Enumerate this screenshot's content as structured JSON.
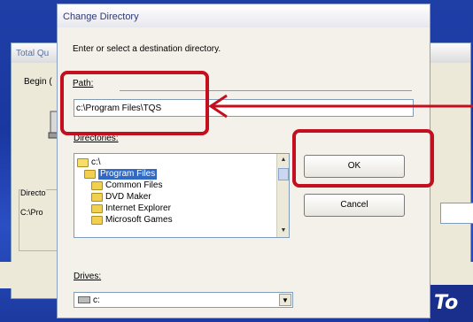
{
  "background_window": {
    "title": "Total Qu",
    "begin_text": "Begin (",
    "directory_label": "Directo",
    "directory_value": "C:\\Pro"
  },
  "brand": {
    "text": "To"
  },
  "dialog": {
    "title": "Change Directory",
    "prompt": "Enter or select a destination directory.",
    "path_label": "Path:",
    "path_value": "c:\\Program Files\\TQS",
    "directories_label": "Directories:",
    "directories": [
      {
        "label": "c:\\",
        "state": "open"
      },
      {
        "label": "Program Files",
        "state": "selected"
      },
      {
        "label": "Common Files",
        "state": "closed"
      },
      {
        "label": "DVD Maker",
        "state": "closed"
      },
      {
        "label": "Internet Explorer",
        "state": "closed"
      },
      {
        "label": "Microsoft Games",
        "state": "closed"
      }
    ],
    "drives_label": "Drives:",
    "drive_value": "c:",
    "ok_label": "OK",
    "cancel_label": "Cancel"
  },
  "colors": {
    "highlight": "#c40f1e",
    "selection": "#316ac5",
    "desktop": "#1f3fa7"
  }
}
